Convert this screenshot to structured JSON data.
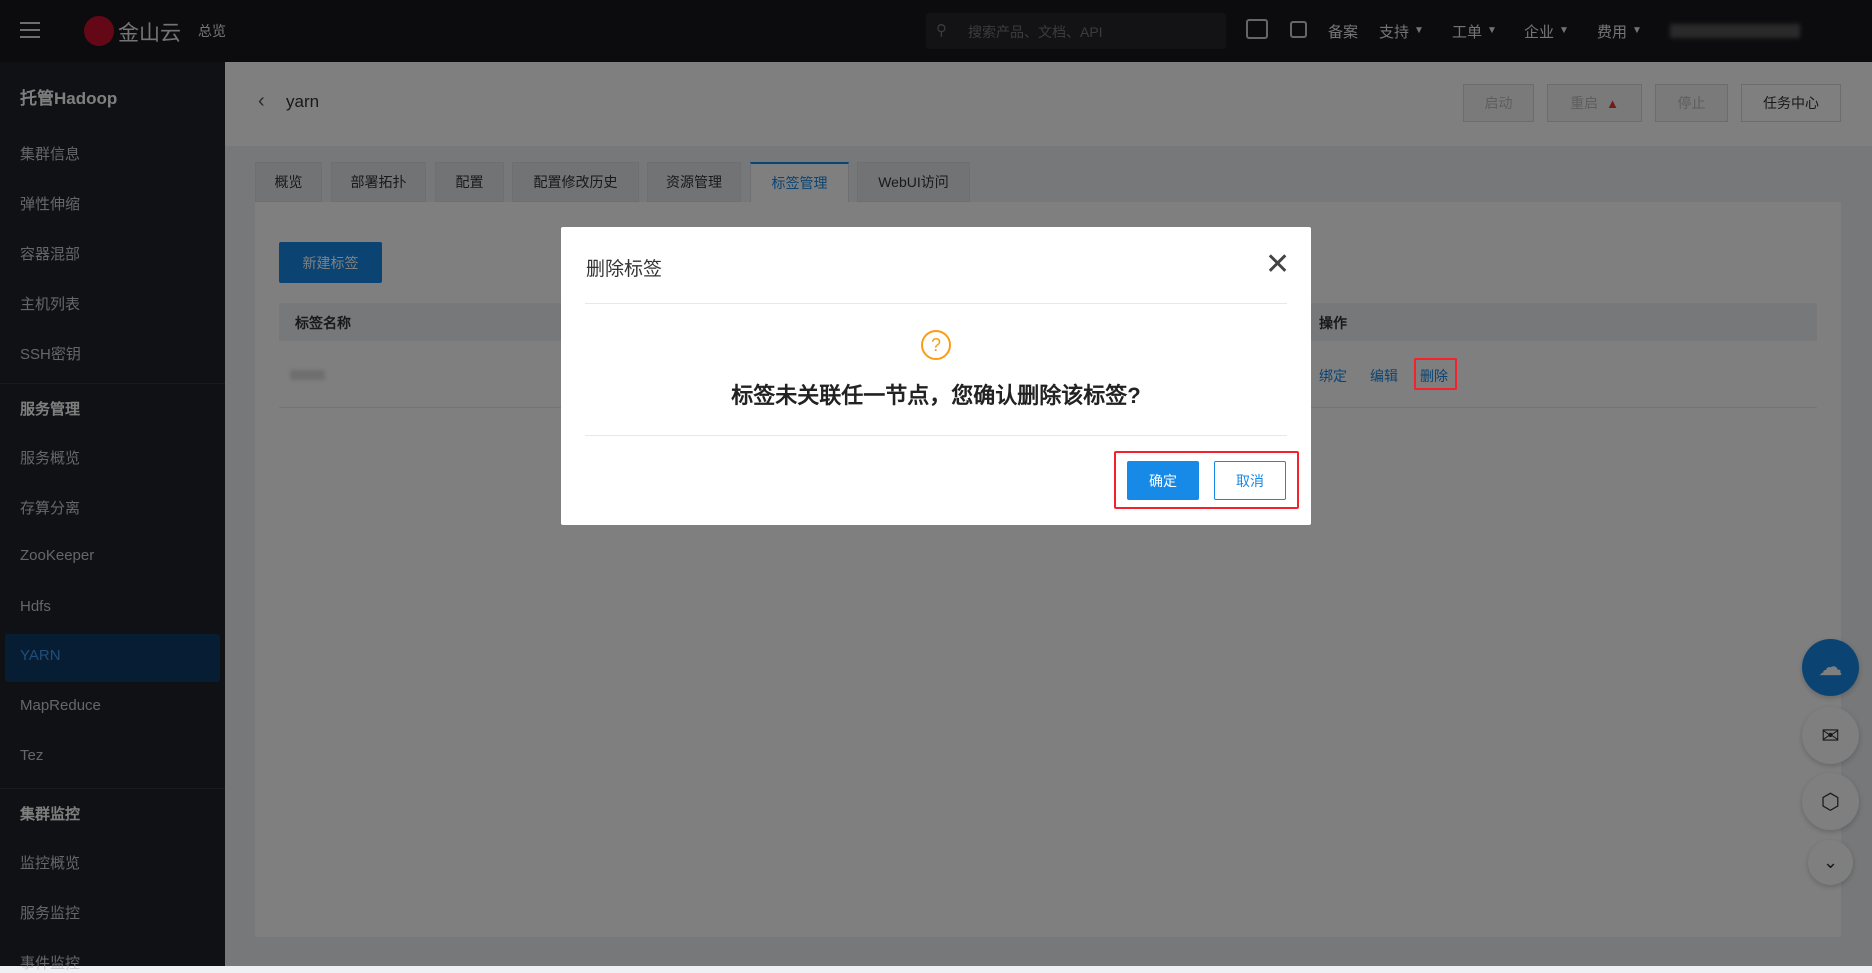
{
  "topbar": {
    "brand": "金山云",
    "overview": "总览",
    "search_placeholder": "搜索产品、文档、API",
    "beian": "备案",
    "support": "支持",
    "ticket": "工单",
    "enterprise": "企业",
    "billing": "费用"
  },
  "sidebar": {
    "title": "托管Hadoop",
    "items": [
      "集群信息",
      "弹性伸缩",
      "容器混部",
      "主机列表",
      "SSH密钥"
    ],
    "section2": "服务管理",
    "items2": [
      "服务概览",
      "存算分离",
      "ZooKeeper",
      "Hdfs",
      "YARN",
      "MapReduce",
      "Tez"
    ],
    "section3": "集群监控",
    "items3": [
      "监控概览",
      "服务监控",
      "事件监控"
    ]
  },
  "header": {
    "title": "yarn",
    "buttons": [
      "启动",
      "重启",
      "停止",
      "任务中心"
    ]
  },
  "tabs": [
    "概览",
    "部署拓扑",
    "配置",
    "配置修改历史",
    "资源管理",
    "标签管理",
    "WebUI访问"
  ],
  "content": {
    "new_label": "新建标签",
    "col_name": "标签名称",
    "col_action": "操作",
    "actions": [
      "绑定",
      "编辑",
      "删除"
    ]
  },
  "dialog": {
    "title": "删除标签",
    "message": "标签未关联任一节点，您确认删除该标签?",
    "confirm": "确定",
    "cancel": "取消"
  },
  "colors": {
    "accent": "#1789e6",
    "warning": "#fa9d14",
    "highlight": "#f5222d"
  }
}
